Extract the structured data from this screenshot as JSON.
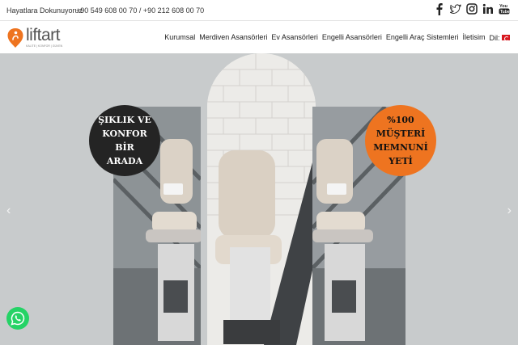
{
  "topbar": {
    "tagline": "Hayatlara Dokunuyoruz",
    "phones": "+90 549 608 00 70 / +90 212 608 00 70",
    "social": [
      "facebook-icon",
      "twitter-icon",
      "instagram-icon",
      "linkedin-icon",
      "youtube-icon"
    ]
  },
  "brand": {
    "name": "liftart",
    "tagline": "KALİTE | KONFOR | GÜVEN"
  },
  "nav": {
    "items": [
      "Kurumsal",
      "Merdiven Asansörleri",
      "Ev Asansörleri",
      "Engelli Asansörleri",
      "Engelli Araç Sistemleri",
      "İletisim",
      "Dil:"
    ],
    "language_flag": "tr-flag-icon"
  },
  "hero": {
    "badge_left": "ŞIKLIK VE\nKONFOR\nBİR\nARADA",
    "badge_right": "%100\nMÜŞTERİ\nMEMNUNİ\nYETİ",
    "prev_arrow": "‹",
    "next_arrow": "›"
  },
  "colors": {
    "brand_orange": "#ee7420",
    "badge_dark": "#242424",
    "whatsapp": "#25d366",
    "hero_bg": "#c8cbcc"
  },
  "floating": {
    "whatsapp_icon": "whatsapp-icon"
  }
}
